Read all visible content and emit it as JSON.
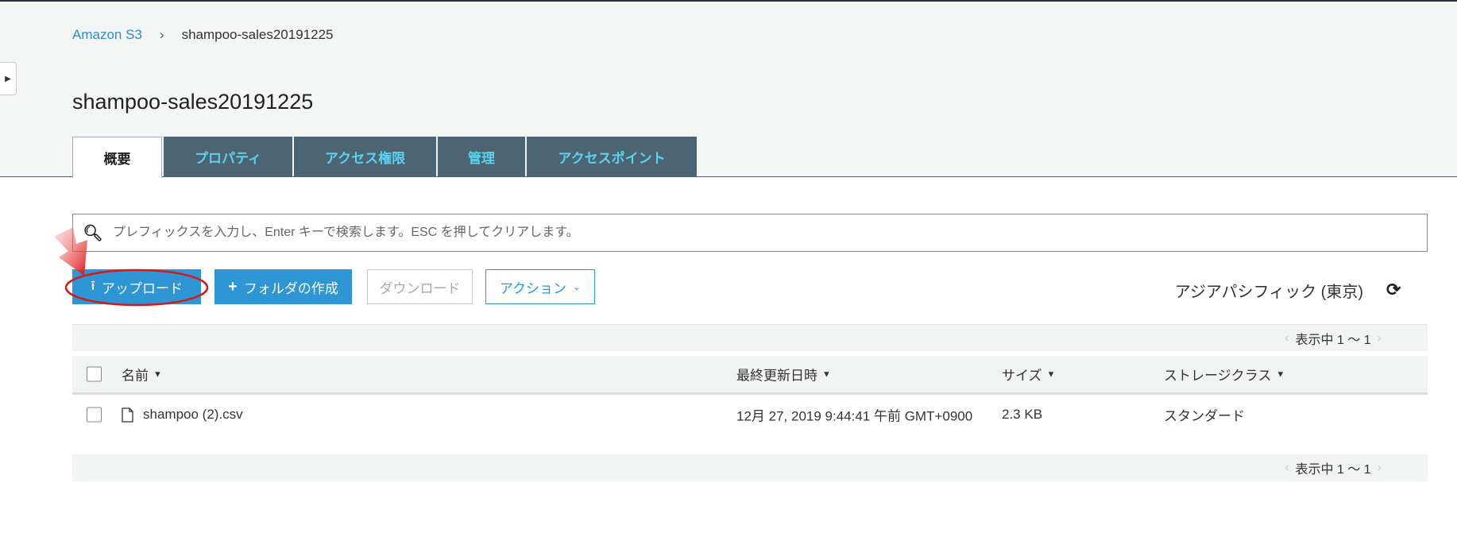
{
  "breadcrumb": {
    "root": "Amazon S3",
    "separator": "›",
    "current": "shampoo-sales20191225"
  },
  "page_title": "shampoo-sales20191225",
  "tabs": [
    {
      "label": "概要",
      "active": true
    },
    {
      "label": "プロパティ"
    },
    {
      "label": "アクセス権限"
    },
    {
      "label": "管理"
    },
    {
      "label": "アクセスポイント"
    }
  ],
  "search": {
    "placeholder": "プレフィックスを入力し、Enter キーで検索します。ESC を押してクリアします。",
    "value": ""
  },
  "toolbar": {
    "upload": "アップロード",
    "create_folder": "フォルダの作成",
    "download": "ダウンロード",
    "actions": "アクション",
    "region": "アジアパシフィック (東京)"
  },
  "pager": {
    "text": "表示中 1 ～ 1"
  },
  "columns": {
    "name": "名前",
    "modified": "最終更新日時",
    "size": "サイズ",
    "storage_class": "ストレージクラス"
  },
  "rows": [
    {
      "name": "shampoo (2).csv",
      "modified": "12月 27, 2019 9:44:41 午前 GMT+0900",
      "size": "2.3 KB",
      "storage_class": "スタンダード"
    }
  ],
  "colors": {
    "accent": "#2f96d6",
    "tab_bg": "#4d6473",
    "tab_text": "#5ad3f0",
    "annotation": "#e02020"
  }
}
